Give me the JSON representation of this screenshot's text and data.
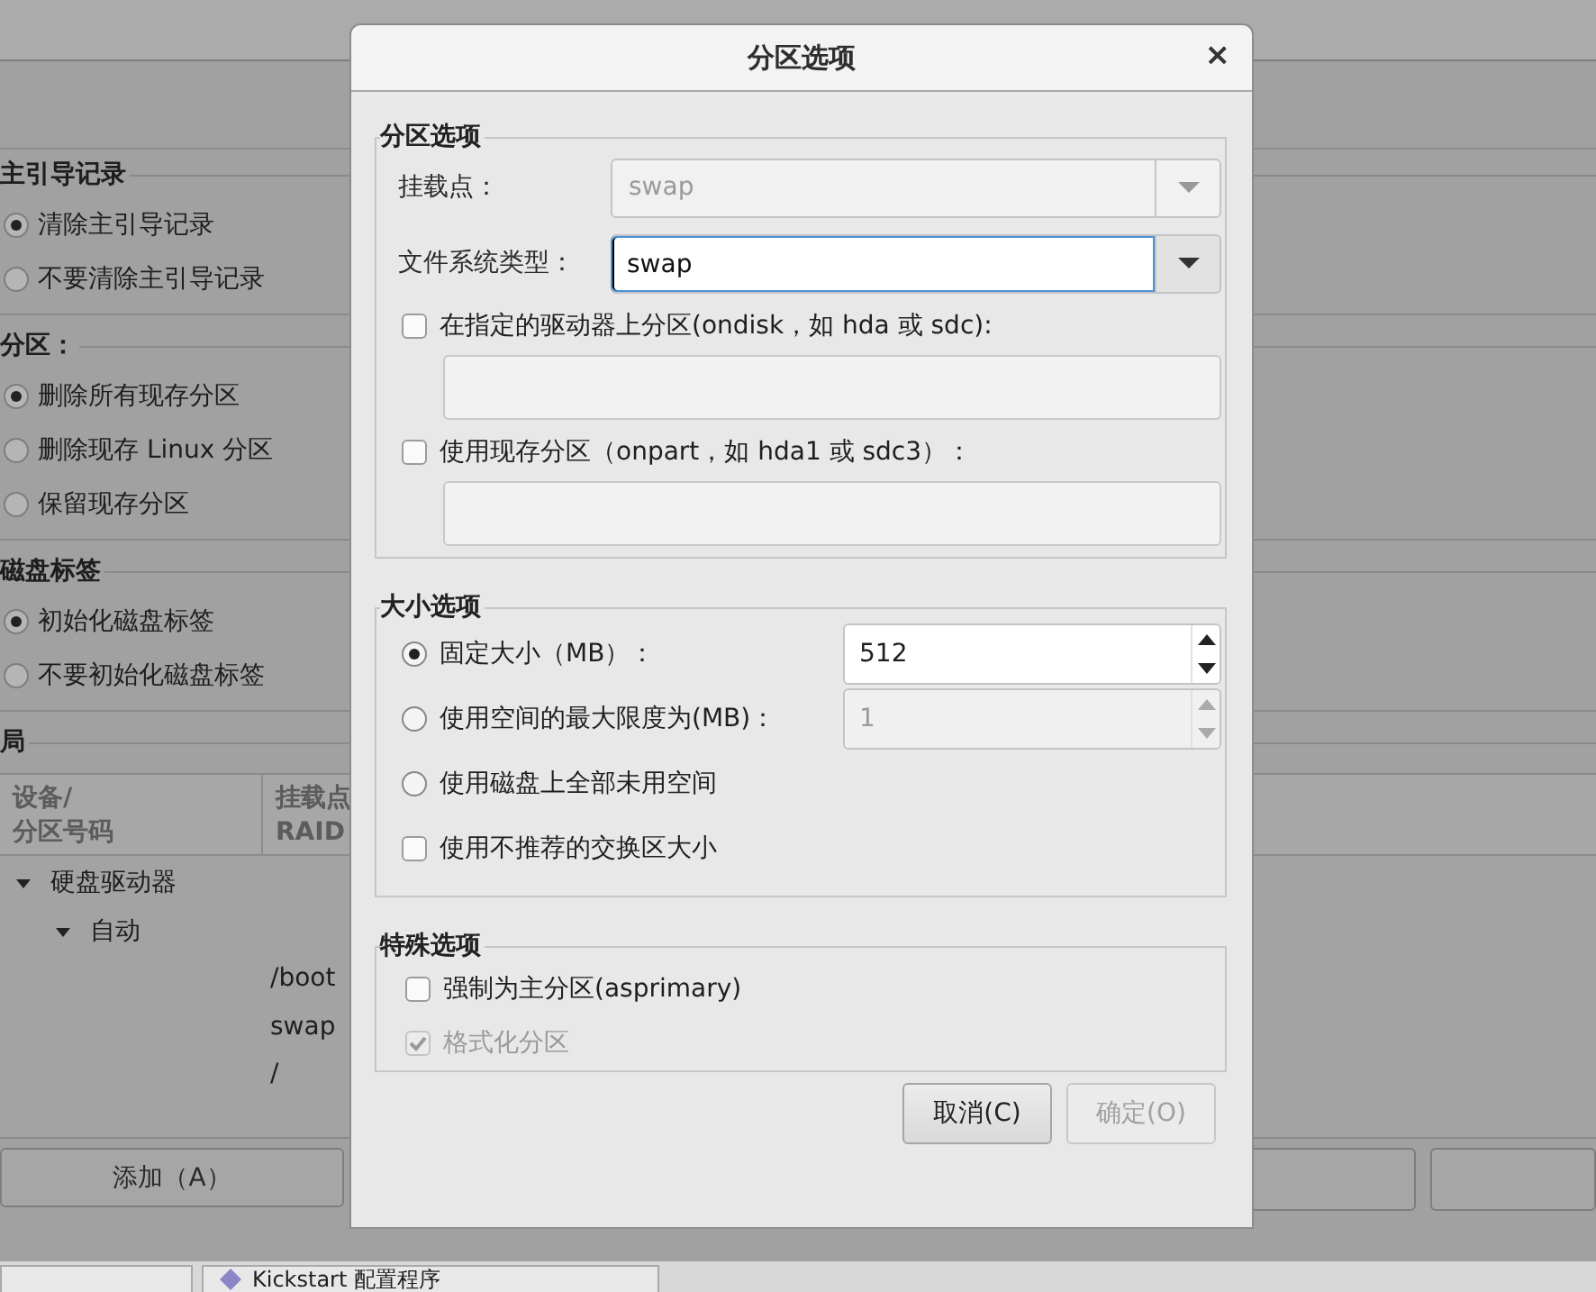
{
  "background_window": {
    "sections": [
      {
        "title": "主引导记录",
        "options": [
          {
            "label": "清除主引导记录",
            "selected": true
          },
          {
            "label": "不要清除主引导记录",
            "selected": false
          }
        ]
      },
      {
        "title": "分区：",
        "options": [
          {
            "label": "删除所有现存分区",
            "selected": true
          },
          {
            "label": "删除现存  Linux 分区",
            "selected": false
          },
          {
            "label": "保留现存分区",
            "selected": false
          }
        ]
      },
      {
        "title": "磁盘标签",
        "options": [
          {
            "label": "初始化磁盘标签",
            "selected": true
          },
          {
            "label": "不要初始化磁盘标签",
            "selected": false
          }
        ]
      }
    ],
    "layout": {
      "title": "局",
      "columns": [
        {
          "lines": [
            "设备/",
            "分区号码"
          ]
        },
        {
          "lines": [
            "挂载点",
            "RAID"
          ]
        }
      ],
      "rows": [
        {
          "device": "硬盘驱动器",
          "expanded": true,
          "children": [
            {
              "device": "自动",
              "expanded": true,
              "children": [
                {
                  "mount": "/boot"
                },
                {
                  "mount": "swap"
                },
                {
                  "mount": "/"
                }
              ]
            }
          ]
        }
      ],
      "buttons": [
        "添加（A）"
      ]
    },
    "taskbar": [
      {
        "label": "Kickstart 配置程序"
      }
    ]
  },
  "dialog": {
    "title": "分区选项",
    "close": "×",
    "partition_group": {
      "title": "分区选项",
      "mount_point": {
        "label": "挂载点：",
        "value": "swap",
        "disabled": true
      },
      "fs_type": {
        "label": "文件系统类型：",
        "value": "swap",
        "disabled": false,
        "focused": true
      },
      "checks": [
        {
          "label": "在指定的驱动器上分区(ondisk，如  hda 或  sdc):",
          "checked": false
        },
        {
          "label": "使用现存分区（onpart，如  hda1 或  sdc3）：",
          "checked": false
        }
      ]
    },
    "size_group": {
      "title": "大小选项",
      "options": [
        {
          "kind": "radio",
          "label": "固定大小（MB）：",
          "selected": true,
          "value": "512",
          "disabled": false
        },
        {
          "kind": "radio",
          "label": "使用空间的最大限度为(MB)：",
          "selected": false,
          "value": "1",
          "disabled": true
        },
        {
          "kind": "radio",
          "label": "使用磁盘上全部未用空间",
          "selected": false
        },
        {
          "kind": "checkbox",
          "label": "使用不推荐的交换区大小",
          "checked": false
        }
      ]
    },
    "special_group": {
      "title": "特殊选项",
      "options": [
        {
          "label": "强制为主分区(asprimary)",
          "checked": false,
          "disabled": false
        },
        {
          "label": "格式化分区",
          "checked": true,
          "disabled": true
        }
      ]
    },
    "buttons": [
      {
        "label": "取消(C)",
        "disabled": false
      },
      {
        "label": "确定(O)",
        "disabled": true
      }
    ]
  }
}
